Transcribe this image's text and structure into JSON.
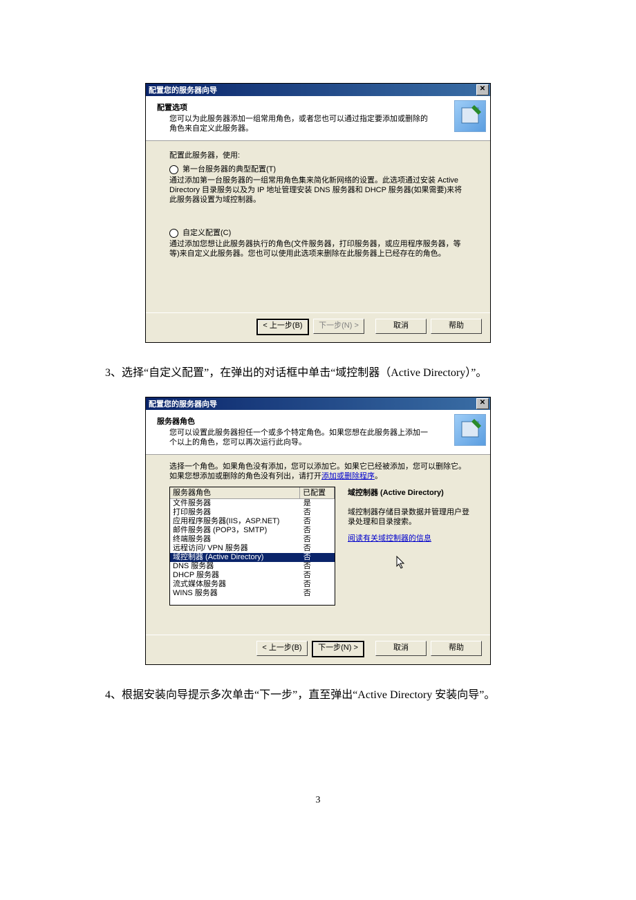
{
  "dialog1": {
    "title": "配置您的服务器向导",
    "header_title": "配置选项",
    "header_sub": "您可以为此服务器添加一组常用角色，或者您也可以通过指定要添加或删除的角色来自定义此服务器。",
    "prompt": "配置此服务器，使用:",
    "opt1_label": "第一台服务器的典型配置(T)",
    "opt1_desc": "通过添加第一台服务器的一组常用角色集来简化新网络的设置。此选项通过安装 Active Directory 目录服务以及为 IP 地址管理安装 DNS 服务器和 DHCP 服务器(如果需要)来将此服务器设置为域控制器。",
    "opt2_label": "自定义配置(C)",
    "opt2_desc": "通过添加您想让此服务器执行的角色(文件服务器，打印服务器，或应用程序服务器，等等)来自定义此服务器。您也可以使用此选项来删除在此服务器上已经存在的角色。",
    "btn_back": "< 上一步(B)",
    "btn_next": "下一步(N) >",
    "btn_cancel": "取消",
    "btn_help": "帮助"
  },
  "text3": "3、选择“自定义配置”，在弹出的对话框中单击“域控制器（Active Directory）”。",
  "dialog2": {
    "title": "配置您的服务器向导",
    "header_title": "服务器角色",
    "header_sub": "您可以设置此服务器担任一个或多个特定角色。如果您想在此服务器上添加一个以上的角色，您可以再次运行此向导。",
    "intro_a": "选择一个角色。如果角色没有添加，您可以添加它。如果它已经被添加，您可以删除它。如果您想添加或删除的角色没有列出，请打开",
    "intro_link": "添加或删除程序",
    "intro_b": "。",
    "col_name": "服务器角色",
    "col_conf": "已配置",
    "rows": [
      {
        "name": "文件服务器",
        "conf": "是"
      },
      {
        "name": "打印服务器",
        "conf": "否"
      },
      {
        "name": "应用程序服务器(IIS，ASP.NET)",
        "conf": "否"
      },
      {
        "name": "邮件服务器 (POP3，SMTP)",
        "conf": "否"
      },
      {
        "name": "终端服务器",
        "conf": "否"
      },
      {
        "name": "远程访问/ VPN 服务器",
        "conf": "否"
      },
      {
        "name": "域控制器 (Active Directory)",
        "conf": "否",
        "selected": true
      },
      {
        "name": "DNS 服务器",
        "conf": "否"
      },
      {
        "name": "DHCP 服务器",
        "conf": "否"
      },
      {
        "name": "流式媒体服务器",
        "conf": "否"
      },
      {
        "name": "WINS 服务器",
        "conf": "否"
      }
    ],
    "right_title": "域控制器 (Active Directory)",
    "right_desc": "域控制器存储目录数据并管理用户登录处理和目录搜索。",
    "right_link": "阅读有关域控制器的信息",
    "btn_back": "< 上一步(B)",
    "btn_next": "下一步(N) >",
    "btn_cancel": "取消",
    "btn_help": "帮助"
  },
  "text4": "4、根据安装向导提示多次单击“下一步”，直至弹出“Active Directory 安装向导”。",
  "page_number": "3"
}
